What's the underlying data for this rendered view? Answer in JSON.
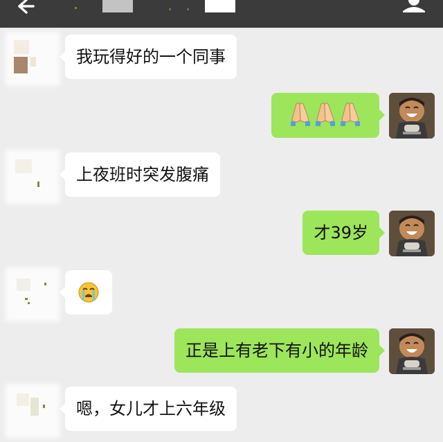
{
  "topbar": {
    "back_icon": "back-arrow-icon",
    "more_icon": "profile-icon"
  },
  "messages": [
    {
      "side": "left",
      "text": "我玩得好的一个同事"
    },
    {
      "side": "right",
      "text": "",
      "emoji": [
        "folded-hands-icon",
        "folded-hands-icon",
        "folded-hands-icon"
      ]
    },
    {
      "side": "left",
      "text": "上夜班时突发腹痛"
    },
    {
      "side": "right",
      "text": "才39岁"
    },
    {
      "side": "left",
      "text": "",
      "emoji": [
        "loudly-crying-face-icon"
      ]
    },
    {
      "side": "right",
      "text": "正是上有老下有小的年龄"
    },
    {
      "side": "left",
      "text": "嗯，女儿才上六年级"
    }
  ],
  "colors": {
    "topbar": "#3b3b3b",
    "background": "#ededed",
    "own_bubble": "#9de55b",
    "other_bubble": "#ffffff"
  }
}
